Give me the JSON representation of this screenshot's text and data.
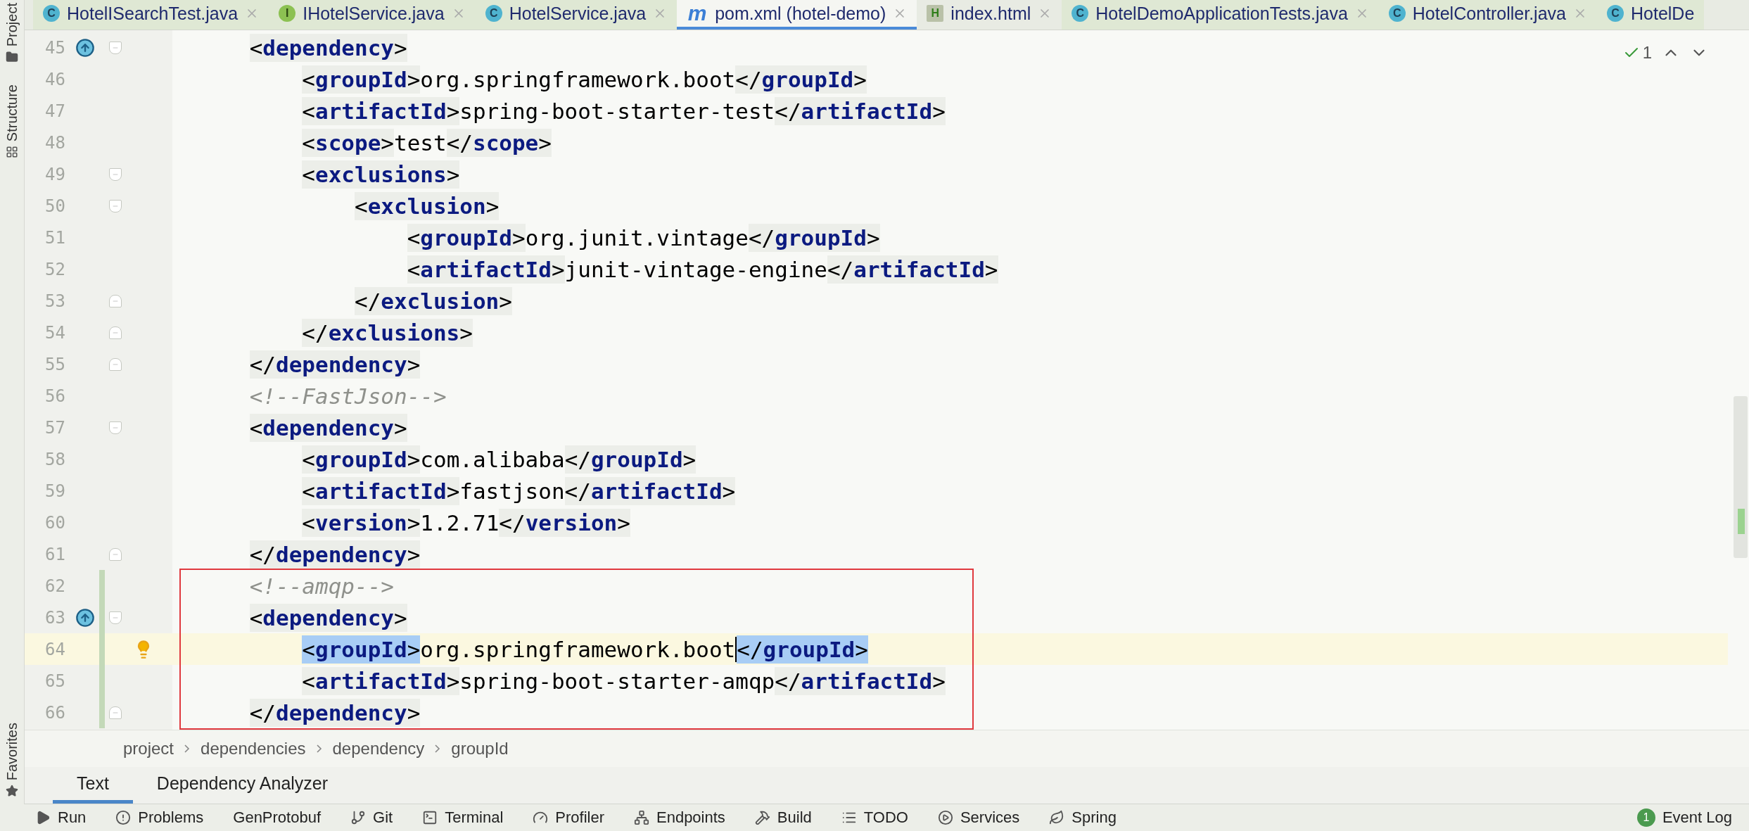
{
  "left_stripe": [
    {
      "label": "Project",
      "kind": "folder"
    },
    {
      "label": "Structure",
      "kind": "structure"
    }
  ],
  "left_stripe_bottom": [
    {
      "label": "Favorites",
      "kind": "star"
    }
  ],
  "tabs": [
    {
      "label": "HotelISearchTest.java",
      "kind": "class",
      "badge": "C",
      "selected": false,
      "closable": true
    },
    {
      "label": "IHotelService.java",
      "kind": "interface",
      "badge": "I",
      "selected": false,
      "closable": true
    },
    {
      "label": "HotelService.java",
      "kind": "class",
      "badge": "C",
      "selected": false,
      "closable": true
    },
    {
      "label": "pom.xml (hotel-demo)",
      "kind": "maven",
      "badge": "m",
      "selected": true,
      "closable": true
    },
    {
      "label": "index.html",
      "kind": "html",
      "badge": "H",
      "selected": false,
      "closable": true
    },
    {
      "label": "HotelDemoApplicationTests.java",
      "kind": "class",
      "badge": "C",
      "selected": false,
      "closable": true
    },
    {
      "label": "HotelController.java",
      "kind": "class",
      "badge": "C",
      "selected": false,
      "closable": true
    },
    {
      "label": "HotelDe",
      "kind": "class",
      "badge": "C",
      "selected": false,
      "closable": false
    }
  ],
  "inspections": {
    "count": "1"
  },
  "editor": {
    "lines": [
      {
        "number": "45",
        "fold_open": true,
        "override_marker": true,
        "segments": [
          {
            "kind": "tag",
            "text": "    <dependency>"
          }
        ]
      },
      {
        "number": "46",
        "segments": [
          {
            "kind": "tag",
            "text": "        <groupId>"
          },
          {
            "kind": "text",
            "text": "org.springframework.boot"
          },
          {
            "kind": "tag",
            "text": "</groupId>"
          }
        ]
      },
      {
        "number": "47",
        "segments": [
          {
            "kind": "tag",
            "text": "        <artifactId>"
          },
          {
            "kind": "text",
            "text": "spring-boot-starter-test"
          },
          {
            "kind": "tag",
            "text": "</artifactId>"
          }
        ]
      },
      {
        "number": "48",
        "segments": [
          {
            "kind": "tag",
            "text": "        <scope>"
          },
          {
            "kind": "text",
            "text": "test"
          },
          {
            "kind": "tag",
            "text": "</scope>"
          }
        ]
      },
      {
        "number": "49",
        "fold_open": true,
        "segments": [
          {
            "kind": "tag",
            "text": "        <exclusions>"
          }
        ]
      },
      {
        "number": "50",
        "fold_open": true,
        "segments": [
          {
            "kind": "tag",
            "text": "            <exclusion>"
          }
        ]
      },
      {
        "number": "51",
        "segments": [
          {
            "kind": "tag",
            "text": "                <groupId>"
          },
          {
            "kind": "text",
            "text": "org.junit.vintage"
          },
          {
            "kind": "tag",
            "text": "</groupId>"
          }
        ]
      },
      {
        "number": "52",
        "segments": [
          {
            "kind": "tag",
            "text": "                <artifactId>"
          },
          {
            "kind": "text",
            "text": "junit-vintage-engine"
          },
          {
            "kind": "tag",
            "text": "</artifactId>"
          }
        ]
      },
      {
        "number": "53",
        "fold_close": true,
        "segments": [
          {
            "kind": "tag",
            "text": "            </exclusion>"
          }
        ]
      },
      {
        "number": "54",
        "fold_close": true,
        "segments": [
          {
            "kind": "tag",
            "text": "        </exclusions>"
          }
        ]
      },
      {
        "number": "55",
        "fold_close": true,
        "segments": [
          {
            "kind": "tag",
            "text": "    </dependency>"
          }
        ]
      },
      {
        "number": "56",
        "segments": [
          {
            "kind": "comment",
            "text": "    <!--FastJson-->"
          }
        ]
      },
      {
        "number": "57",
        "fold_open": true,
        "segments": [
          {
            "kind": "tag",
            "text": "    <dependency>"
          }
        ]
      },
      {
        "number": "58",
        "segments": [
          {
            "kind": "tag",
            "text": "        <groupId>"
          },
          {
            "kind": "text",
            "text": "com.alibaba"
          },
          {
            "kind": "tag",
            "text": "</groupId>"
          }
        ]
      },
      {
        "number": "59",
        "segments": [
          {
            "kind": "tag",
            "text": "        <artifactId>"
          },
          {
            "kind": "text",
            "text": "fastjson"
          },
          {
            "kind": "tag",
            "text": "</artifactId>"
          }
        ]
      },
      {
        "number": "60",
        "segments": [
          {
            "kind": "tag",
            "text": "        <version>"
          },
          {
            "kind": "text",
            "text": "1.2.71"
          },
          {
            "kind": "tag",
            "text": "</version>"
          }
        ]
      },
      {
        "number": "61",
        "fold_close": true,
        "segments": [
          {
            "kind": "tag",
            "text": "    </dependency>"
          }
        ]
      },
      {
        "number": "62",
        "changed": true,
        "boxed": true,
        "segments": [
          {
            "kind": "comment",
            "text": "    <!--amqp-->"
          }
        ]
      },
      {
        "number": "63",
        "fold_open": true,
        "override_marker": true,
        "changed": true,
        "boxed": true,
        "segments": [
          {
            "kind": "tag",
            "text": "    <dependency>"
          }
        ]
      },
      {
        "number": "64",
        "current": true,
        "hint": true,
        "changed": true,
        "boxed": true,
        "segments": [
          {
            "kind": "tag",
            "text": "        <groupId>",
            "selected": true
          },
          {
            "kind": "text",
            "text": "org.springframework.boot"
          },
          {
            "kind": "tag",
            "text": "</groupId>",
            "selected": true,
            "caret": true
          }
        ]
      },
      {
        "number": "65",
        "changed": true,
        "boxed": true,
        "segments": [
          {
            "kind": "tag",
            "text": "        <artifactId>"
          },
          {
            "kind": "text",
            "text": "spring-boot-starter-amqp"
          },
          {
            "kind": "tag",
            "text": "</artifactId>"
          }
        ]
      },
      {
        "number": "66",
        "fold_close": true,
        "changed": true,
        "boxed": true,
        "segments": [
          {
            "kind": "tag",
            "text": "    </dependency>"
          }
        ]
      }
    ]
  },
  "breadcrumbs": [
    "project",
    "dependencies",
    "dependency",
    "groupId"
  ],
  "editor_tabs": [
    {
      "label": "Text",
      "selected": true
    },
    {
      "label": "Dependency Analyzer",
      "selected": false
    }
  ],
  "tool_windows": [
    {
      "label": "Run",
      "kind": "run"
    },
    {
      "label": "Problems",
      "kind": "problems"
    },
    {
      "label": "GenProtobuf"
    },
    {
      "label": "Git",
      "kind": "git"
    },
    {
      "label": "Terminal",
      "kind": "terminal"
    },
    {
      "label": "Profiler",
      "kind": "profiler"
    },
    {
      "label": "Endpoints",
      "kind": "endpoints"
    },
    {
      "label": "Build",
      "kind": "build"
    },
    {
      "label": "TODO",
      "kind": "todo"
    },
    {
      "label": "Services",
      "kind": "services"
    },
    {
      "label": "Spring",
      "kind": "spring"
    }
  ],
  "event_log": {
    "label": "Event Log",
    "badge": "1"
  }
}
